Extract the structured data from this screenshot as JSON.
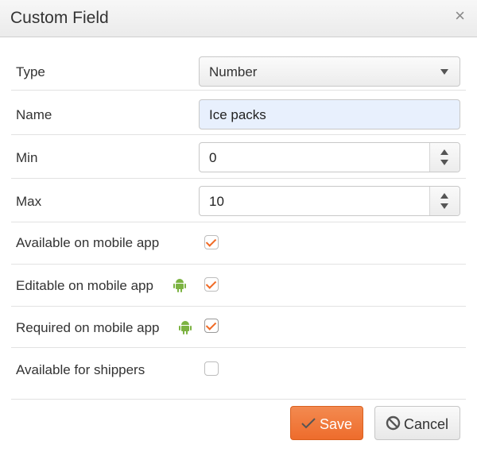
{
  "dialog": {
    "title": "Custom Field",
    "close_label": "×"
  },
  "fields": {
    "type": {
      "label": "Type",
      "value": "Number"
    },
    "name": {
      "label": "Name",
      "value": "Ice packs"
    },
    "min": {
      "label": "Min",
      "value": "0"
    },
    "max": {
      "label": "Max",
      "value": "10"
    }
  },
  "options": [
    {
      "label": "Available on mobile app",
      "checked": true,
      "android_icon": false
    },
    {
      "label": "Editable on mobile app",
      "checked": true,
      "android_icon": true
    },
    {
      "label": "Required on mobile app",
      "checked": true,
      "android_icon": true
    },
    {
      "label": "Available for shippers",
      "checked": false,
      "android_icon": false
    }
  ],
  "footer": {
    "save_label": "Save",
    "cancel_label": "Cancel"
  },
  "colors": {
    "accent": "#ee6c2c",
    "android": "#7cb342",
    "input_focus_bg": "#e8f0fd"
  }
}
